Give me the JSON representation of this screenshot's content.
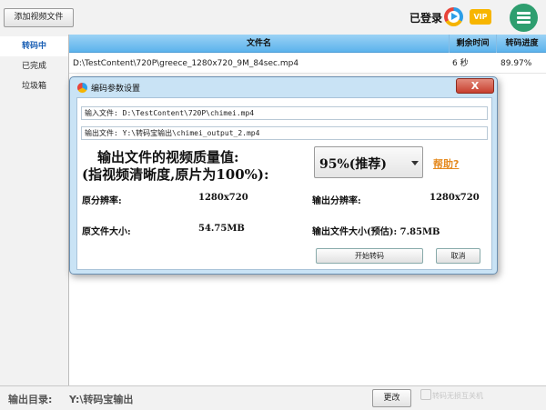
{
  "toolbar": {
    "add_video_label": "添加视频文件",
    "login_label": "已登录",
    "vip_label": "VIP"
  },
  "sidebar": {
    "items": [
      {
        "label": "转码中"
      },
      {
        "label": "已完成"
      },
      {
        "label": "垃圾箱"
      }
    ]
  },
  "table": {
    "headers": [
      "文件名",
      "剩余时间",
      "转码进度"
    ],
    "rows": [
      {
        "filename": "D:\\TestContent\\720P\\greece_1280x720_9M_84sec.mp4",
        "remaining": "6 秒",
        "progress": "89.97%"
      }
    ]
  },
  "dialog": {
    "title": "编码参数设置",
    "close_label": "X",
    "input_file": "输入文件: D:\\TestContent\\720P\\chimei.mp4",
    "output_file": "输出文件: Y:\\转码宝输出\\chimei_output_2.mp4",
    "quality_line1": "输出文件的视频质量值:",
    "quality_line2": "(指视频清晰度,原片为100%):",
    "quality_value": "95%(推荐)",
    "help_label": "帮助?",
    "src_res_label": "原分辨率:",
    "src_res_value": "1280x720",
    "out_res_label": "输出分辨率:",
    "out_res_value": "1280x720",
    "src_size_label": "原文件大小:",
    "src_size_value": "54.75MB",
    "out_size_label": "输出文件大小(预估): 7.85MB",
    "start_label": "开始转码",
    "cancel_label": "取消"
  },
  "bottom": {
    "output_dir_label": "输出目录:",
    "output_dir_value": "Y:\\转码宝输出",
    "change_label": "更改",
    "watermark": "转码无损互关机"
  },
  "colors": {
    "accent": "#1a5fb4",
    "header_blue": "#5cb3ec",
    "menu_green": "#2e9e6f",
    "help_orange": "#e58a1f",
    "close_red": "#c7402f"
  },
  "icons": [
    "play-icon",
    "vip-icon",
    "menu-icon",
    "app-icon",
    "close-icon",
    "dropdown-caret-icon"
  ]
}
